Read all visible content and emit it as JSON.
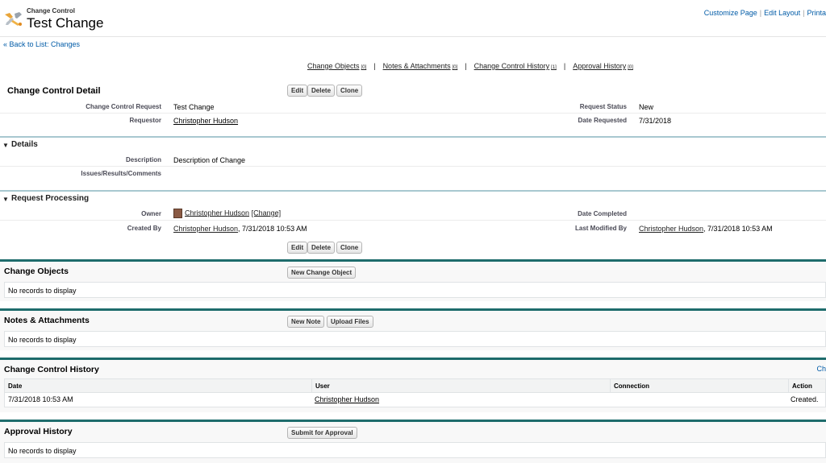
{
  "header": {
    "subtitle": "Change Control",
    "title": "Test Change",
    "links": [
      "Customize Page",
      "Edit Layout",
      "Printa"
    ],
    "icon": "change-control-tools-icon"
  },
  "back_link": "« Back to List: Changes",
  "related_links": [
    {
      "label": "Change Objects",
      "count": "[0]"
    },
    {
      "label": "Notes & Attachments",
      "count": "[0]"
    },
    {
      "label": "Change Control History",
      "count": "[1]"
    },
    {
      "label": "Approval History",
      "count": "[0]"
    }
  ],
  "related_links_separator": "|",
  "detail": {
    "title": "Change Control Detail",
    "buttons": {
      "edit": "Edit",
      "delete": "Delete",
      "clone": "Clone"
    },
    "fields": {
      "request": {
        "label": "Change Control Request",
        "value": "Test Change"
      },
      "status": {
        "label": "Request Status",
        "value": "New"
      },
      "requestor": {
        "label": "Requestor",
        "value": "Christopher Hudson"
      },
      "date_requested": {
        "label": "Date Requested",
        "value": "7/31/2018"
      }
    },
    "details_section": {
      "title": "Details",
      "description": {
        "label": "Description",
        "value": "Description of Change"
      },
      "issues": {
        "label": "Issues/Results/Comments",
        "value": ""
      }
    },
    "processing_section": {
      "title": "Request Processing",
      "owner": {
        "label": "Owner",
        "value": "Christopher Hudson",
        "change": "[Change]"
      },
      "date_completed": {
        "label": "Date Completed",
        "value": ""
      },
      "created_by": {
        "label": "Created By",
        "user": "Christopher Hudson",
        "stamp": ", 7/31/2018 10:53 AM"
      },
      "modified_by": {
        "label": "Last Modified By",
        "user": "Christopher Hudson",
        "stamp": ", 7/31/2018 10:53 AM"
      }
    }
  },
  "change_objects": {
    "title": "Change Objects",
    "button": "New Change Object",
    "empty": "No records to display"
  },
  "notes": {
    "title": "Notes & Attachments",
    "buttons": [
      "New Note",
      "Upload Files"
    ],
    "empty": "No records to display"
  },
  "history": {
    "title": "Change Control History",
    "show_link": "Ch",
    "columns": [
      "Date",
      "User",
      "Connection",
      "Action"
    ],
    "rows": [
      {
        "date": "7/31/2018 10:53 AM",
        "user": "Christopher Hudson",
        "connection": "",
        "action": "Created."
      }
    ]
  },
  "approval": {
    "title": "Approval History",
    "button": "Submit for Approval",
    "empty": "No records to display"
  },
  "colors": {
    "accent": "#1e6c6c",
    "section_line": "#a8c8d0",
    "link_blue": "#015ba7"
  }
}
